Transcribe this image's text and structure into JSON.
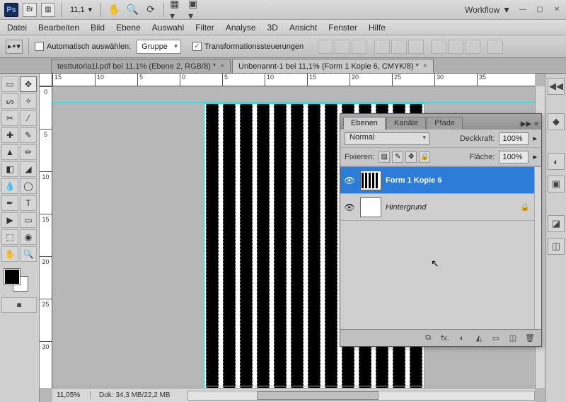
{
  "app": {
    "name": "Ps",
    "bridge": "Br"
  },
  "topbar": {
    "zoom": "11,1",
    "workflow": "Workflow"
  },
  "menu": [
    "Datei",
    "Bearbeiten",
    "Bild",
    "Ebene",
    "Auswahl",
    "Filter",
    "Analyse",
    "3D",
    "Ansicht",
    "Fenster",
    "Hilfe"
  ],
  "options": {
    "auto_select": "Automatisch auswählen:",
    "group": "Gruppe",
    "transform": "Transformationssteuerungen"
  },
  "tabs": [
    {
      "label": "testtutoria1l.pdf bei 11,1% (Ebene 2, RGB/8) *",
      "active": false
    },
    {
      "label": "Unbenannt-1 bei 11,1% (Form 1 Kopie 6, CMYK/8) *",
      "active": true
    }
  ],
  "ruler_h": [
    "15",
    "10",
    "5",
    "0",
    "5",
    "10",
    "15",
    "20",
    "25",
    "30",
    "35"
  ],
  "ruler_v": [
    "0",
    "5",
    "10",
    "15",
    "20",
    "25",
    "30"
  ],
  "statusbar": {
    "zoom": "11,05%",
    "doc": "Dok: 34,3 MB/22,2 MB"
  },
  "panel": {
    "tabs": [
      "Ebenen",
      "Kanäle",
      "Pfade"
    ],
    "blend": "Normal",
    "opacity_label": "Deckkraft:",
    "opacity_value": "100%",
    "lock_label": "Fixieren:",
    "fill_label": "Fläche:",
    "fill_value": "100%",
    "layers": [
      {
        "name": "Form 1 Kopie 6",
        "selected": true,
        "locked": false,
        "thumb": "stripes"
      },
      {
        "name": "Hintergrund",
        "selected": false,
        "locked": true,
        "thumb": "blank"
      }
    ],
    "footer_icons": [
      "⟲",
      "fx.",
      "◐",
      "◭",
      "▭",
      "◫",
      "🗑"
    ]
  }
}
